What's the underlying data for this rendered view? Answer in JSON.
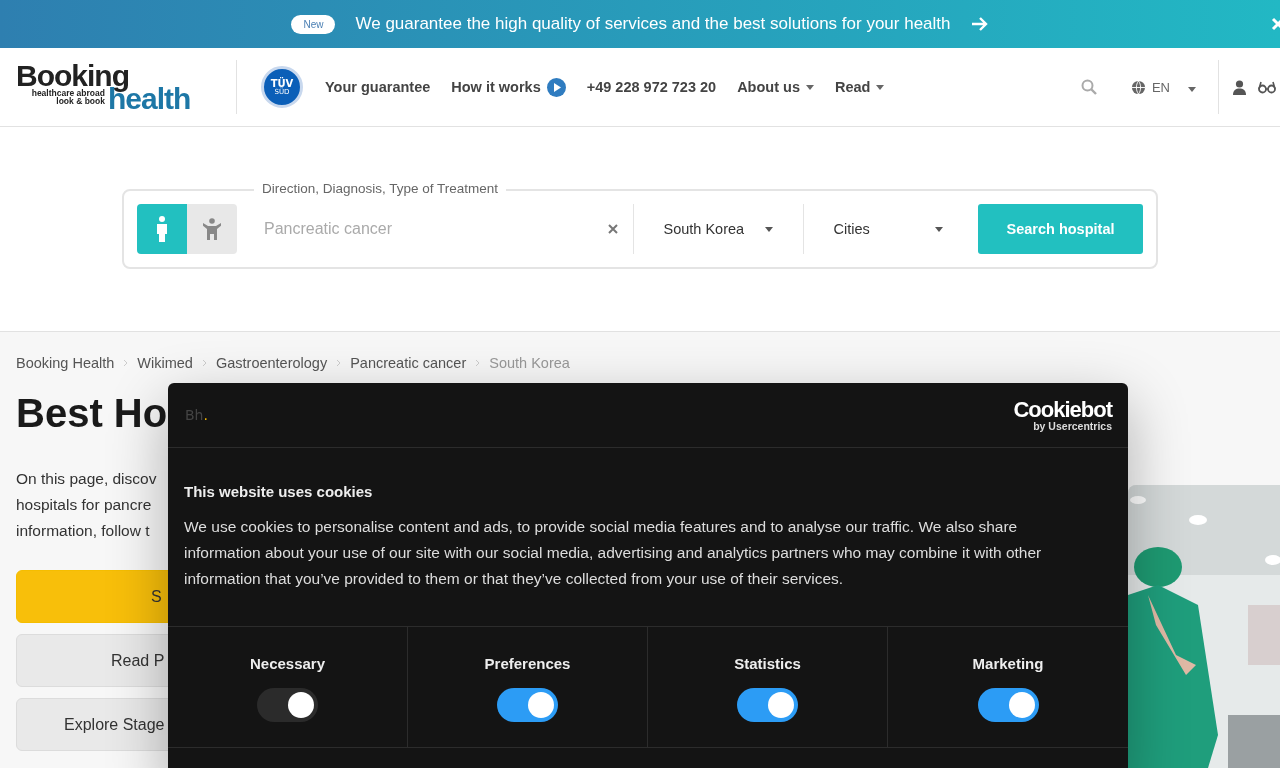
{
  "banner": {
    "badge": "New",
    "message": "We guarantee the high quality of services and the best solutions for your health"
  },
  "header": {
    "logo": {
      "word1": "Booking",
      "tagline1": "healthcare abroad",
      "tagline2": "look & book",
      "word2": "health"
    },
    "seal": {
      "top": "TÜV",
      "bottom": "SÜD"
    },
    "nav": [
      {
        "label": "Your guarantee",
        "kind": "link"
      },
      {
        "label": "How it works",
        "kind": "play"
      },
      {
        "label": "+49 228 972 723 20",
        "kind": "link"
      },
      {
        "label": "About us",
        "kind": "menu"
      },
      {
        "label": "Read",
        "kind": "menu"
      }
    ],
    "language": "EN"
  },
  "search": {
    "legend": "Direction, Diagnosis, Type of Treatment",
    "patients": [
      {
        "kind": "adult",
        "selected": true
      },
      {
        "kind": "child",
        "selected": false
      }
    ],
    "placeholder": "Pancreatic cancer",
    "country": "South Korea",
    "city": "Cities",
    "button": "Search hospital"
  },
  "breadcrumb": [
    {
      "label": "Booking Health",
      "current": false
    },
    {
      "label": "Wikimed",
      "current": false
    },
    {
      "label": "Gastroenterology",
      "current": false
    },
    {
      "label": "Pancreatic cancer",
      "current": false
    },
    {
      "label": "South Korea",
      "current": true
    }
  ],
  "page": {
    "title": "Best Ho",
    "intro": [
      "On this page, discov",
      "hospitals for pancre",
      "information, follow t"
    ],
    "buttons": [
      {
        "label": "S",
        "kind": "primary"
      },
      {
        "label": "Read P",
        "kind": "secondary"
      },
      {
        "label": "Explore Stage",
        "kind": "secondary"
      }
    ],
    "photo": {
      "kind": "picture"
    }
  },
  "cookie_dialog": {
    "logo": "Bh",
    "logo_dot": ".",
    "brand": "Cookiebot",
    "brand_sub": "by Usercentrics",
    "title": "This website uses cookies",
    "text": "We use cookies to personalise content and ads, to provide social media features and to analyse our traffic. We also share information about your use of our site with our social media, advertising and analytics partners who may combine it with other information that you’ve provided to them or that they’ve collected from your use of their services.",
    "categories": [
      {
        "label": "Necessary",
        "checked": true,
        "disabled": true
      },
      {
        "label": "Preferences",
        "checked": true,
        "disabled": false
      },
      {
        "label": "Statistics",
        "checked": true,
        "disabled": false
      },
      {
        "label": "Marketing",
        "checked": true,
        "disabled": false
      }
    ]
  }
}
